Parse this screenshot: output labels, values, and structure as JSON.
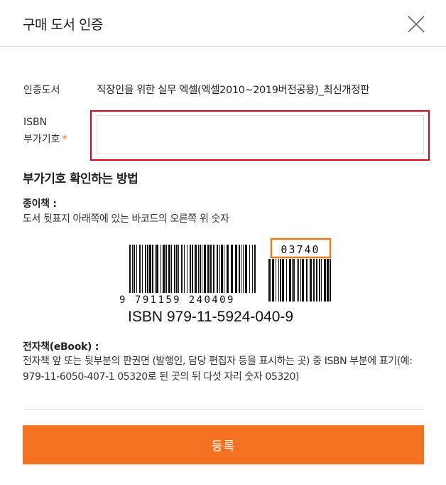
{
  "header": {
    "title": "구매 도서 인증",
    "close_icon": "close-icon"
  },
  "form": {
    "book_label": "인증도서",
    "book_title": "직장인을 위한 실무 엑셀(엑셀2010~2019버전공용)_최신개정판",
    "isbn_label_line1": "ISBN",
    "isbn_label_line2": "부가기호",
    "required_mark": "*",
    "isbn_value": "",
    "isbn_placeholder": ""
  },
  "guide": {
    "title": "부가기호 확인하는 방법",
    "paper_head": "종이책 :",
    "paper_desc": "도서 뒷표지 아래쪽에 있는 바코드의 오른쪽 위 숫자",
    "barcode": {
      "addon_code": "03740",
      "digits_lead": "9",
      "digits_main": "791159 240409",
      "isbn_text": "ISBN 979-11-5924-040-9"
    },
    "ebook_head": "전자책(eBook) :",
    "ebook_desc": "전자책 앞 또는 뒷부분의 판권면 (발행인, 담당 편집자 등을 표시하는 곳) 중 ISBN 부분에 표기(예: 979-11-6050-407-1 05320로 된 곳의 뒤 다섯 자리 숫자 05320)"
  },
  "submit": {
    "label": "등록"
  },
  "colors": {
    "accent": "#f37322",
    "highlight_border": "#e0001b",
    "addon_box": "#e87b1e"
  }
}
